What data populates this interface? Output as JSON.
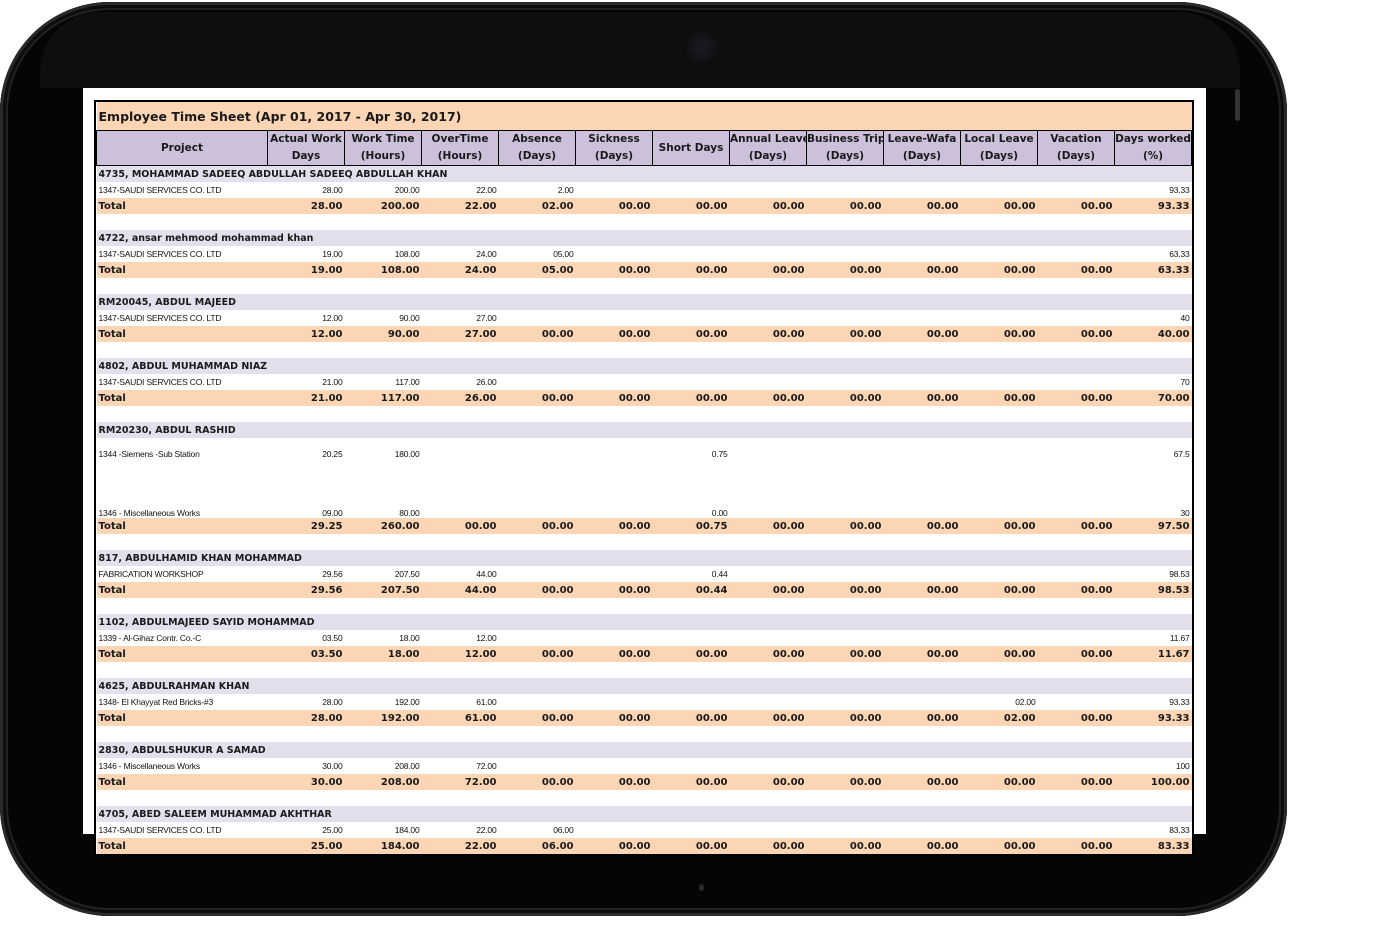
{
  "report": {
    "title": "Employee Time Sheet (Apr 01, 2017 - Apr 30, 2017)",
    "columns": [
      {
        "line1": "Project",
        "line2": ""
      },
      {
        "line1": "Actual Work",
        "line2": "Days"
      },
      {
        "line1": "Work Time",
        "line2": "(Hours)"
      },
      {
        "line1": "OverTime",
        "line2": "(Hours)"
      },
      {
        "line1": "Absence",
        "line2": "(Days)"
      },
      {
        "line1": "Sickness",
        "line2": "(Days)"
      },
      {
        "line1": "Short Days",
        "line2": ""
      },
      {
        "line1": "Annual Leave",
        "line2": "(Days)"
      },
      {
        "line1": "Business Trip",
        "line2": "(Days)"
      },
      {
        "line1": "Leave-Wafa",
        "line2": "(Days)"
      },
      {
        "line1": "Local Leave",
        "line2": "(Days)"
      },
      {
        "line1": "Vacation",
        "line2": "(Days)"
      },
      {
        "line1": "Days worked",
        "line2": "(%)"
      }
    ],
    "total_label": "Total",
    "employees": [
      {
        "name": "4735,  MOHAMMAD SADEEQ ABDULLAH SADEEQ ABDULLAH KHAN",
        "projects": [
          {
            "project": "1347-SAUDI SERVICES CO. LTD",
            "values": [
              "28.00",
              "200.00",
              "22.00",
              "2.00",
              "",
              "",
              "",
              "",
              "",
              "",
              "",
              "93.33"
            ]
          }
        ],
        "total": [
          "28.00",
          "200.00",
          "22.00",
          "02.00",
          "00.00",
          "00.00",
          "00.00",
          "00.00",
          "00.00",
          "00.00",
          "00.00",
          "93.33"
        ]
      },
      {
        "name": "4722,  ansar mehmood mohammad  khan",
        "projects": [
          {
            "project": "1347-SAUDI SERVICES CO. LTD",
            "values": [
              "19.00",
              "108.00",
              "24.00",
              "05.00",
              "",
              "",
              "",
              "",
              "",
              "",
              "",
              "63.33"
            ]
          }
        ],
        "total": [
          "19.00",
          "108.00",
          "24.00",
          "05.00",
          "00.00",
          "00.00",
          "00.00",
          "00.00",
          "00.00",
          "00.00",
          "00.00",
          "63.33"
        ]
      },
      {
        "name": "RM20045, ABDUL MAJEED",
        "projects": [
          {
            "project": "1347-SAUDI SERVICES CO. LTD",
            "values": [
              "12.00",
              "90.00",
              "27.00",
              "",
              "",
              "",
              "",
              "",
              "",
              "",
              "",
              "40"
            ]
          }
        ],
        "total": [
          "12.00",
          "90.00",
          "27.00",
          "00.00",
          "00.00",
          "00.00",
          "00.00",
          "00.00",
          "00.00",
          "00.00",
          "00.00",
          "40.00"
        ]
      },
      {
        "name": "4802, ABDUL MUHAMMAD NIAZ",
        "projects": [
          {
            "project": "1347-SAUDI SERVICES CO. LTD",
            "values": [
              "21.00",
              "117.00",
              "26.00",
              "",
              "",
              "",
              "",
              "",
              "",
              "",
              "",
              "70"
            ]
          }
        ],
        "total": [
          "21.00",
          "117.00",
          "26.00",
          "00.00",
          "00.00",
          "00.00",
          "00.00",
          "00.00",
          "00.00",
          "00.00",
          "00.00",
          "70.00"
        ]
      },
      {
        "name": "RM20230, ABDUL RASHID",
        "projects": [
          {
            "project": "1344 -Siemens -Sub Station",
            "values": [
              "20.25",
              "180.00",
              "",
              "",
              "",
              "0.75",
              "",
              "",
              "",
              "",
              "",
              "67.5"
            ]
          },
          {
            "project": "1346 - Miscellaneous Works",
            "values": [
              "09.00",
              "80.00",
              "",
              "",
              "",
              "0.00",
              "",
              "",
              "",
              "",
              "",
              "30"
            ]
          }
        ],
        "total": [
          "29.25",
          "260.00",
          "00.00",
          "00.00",
          "00.00",
          "00.75",
          "00.00",
          "00.00",
          "00.00",
          "00.00",
          "00.00",
          "97.50"
        ]
      },
      {
        "name": "817, ABDULHAMID KHAN MOHAMMAD",
        "projects": [
          {
            "project": "FABRICATION WORKSHOP",
            "values": [
              "29.56",
              "207.50",
              "44.00",
              "",
              "",
              "0.44",
              "",
              "",
              "",
              "",
              "",
              "98.53"
            ]
          }
        ],
        "total": [
          "29.56",
          "207.50",
          "44.00",
          "00.00",
          "00.00",
          "00.44",
          "00.00",
          "00.00",
          "00.00",
          "00.00",
          "00.00",
          "98.53"
        ]
      },
      {
        "name": "1102, ABDULMAJEED SAYID MOHAMMAD",
        "projects": [
          {
            "project": "1339 - Al-Gihaz Contr. Co.-C",
            "values": [
              "03.50",
              "18.00",
              "12.00",
              "",
              "",
              "",
              "",
              "",
              "",
              "",
              "",
              "11.67"
            ]
          }
        ],
        "total": [
          "03.50",
          "18.00",
          "12.00",
          "00.00",
          "00.00",
          "00.00",
          "00.00",
          "00.00",
          "00.00",
          "00.00",
          "00.00",
          "11.67"
        ]
      },
      {
        "name": "4625, ABDULRAHMAN KHAN",
        "projects": [
          {
            "project": "1348- El Khayyat Red Bricks-#3",
            "values": [
              "28.00",
              "192.00",
              "61.00",
              "",
              "",
              "",
              "",
              "",
              "",
              "02.00",
              "",
              "93.33"
            ]
          }
        ],
        "total": [
          "28.00",
          "192.00",
          "61.00",
          "00.00",
          "00.00",
          "00.00",
          "00.00",
          "00.00",
          "00.00",
          "02.00",
          "00.00",
          "93.33"
        ]
      },
      {
        "name": "2830, ABDULSHUKUR A SAMAD",
        "projects": [
          {
            "project": "1346 - Miscellaneous Works",
            "values": [
              "30.00",
              "208.00",
              "72.00",
              "",
              "",
              "",
              "",
              "",
              "",
              "",
              "",
              "100"
            ]
          }
        ],
        "total": [
          "30.00",
          "208.00",
          "72.00",
          "00.00",
          "00.00",
          "00.00",
          "00.00",
          "00.00",
          "00.00",
          "00.00",
          "00.00",
          "100.00"
        ]
      },
      {
        "name": "4705, ABED  SALEEM MUHAMMAD  AKHTHAR",
        "projects": [
          {
            "project": "1347-SAUDI SERVICES CO. LTD",
            "values": [
              "25.00",
              "184.00",
              "22.00",
              "06.00",
              "",
              "",
              "",
              "",
              "",
              "",
              "",
              "83.33"
            ]
          }
        ],
        "total": [
          "25.00",
          "184.00",
          "22.00",
          "06.00",
          "00.00",
          "00.00",
          "00.00",
          "00.00",
          "00.00",
          "00.00",
          "00.00",
          "83.33"
        ]
      }
    ]
  },
  "colors": {
    "title_bg": "#fcd5b4",
    "header_bg": "#ccc0da",
    "employee_row_bg": "#e4dfec",
    "total_row_bg": "#fcd5b4"
  }
}
